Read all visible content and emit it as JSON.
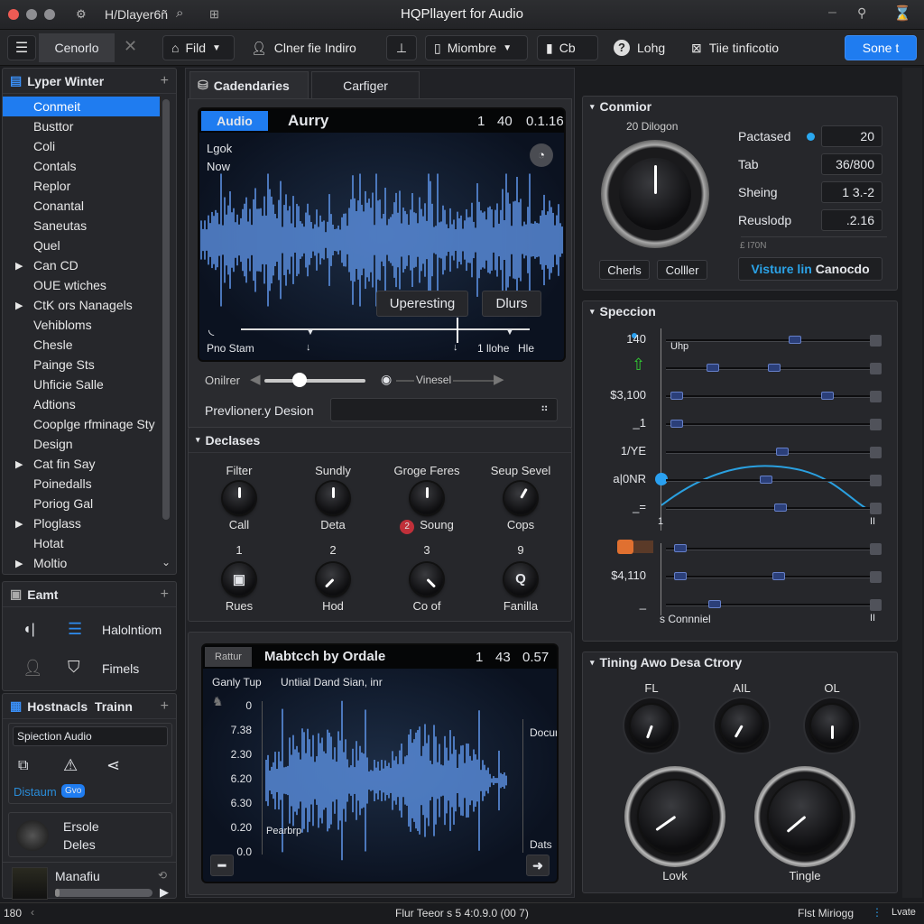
{
  "window": {
    "title": "HQPllayert for Audio",
    "left_label": "H/Dlayer6ñ",
    "controls": [
      "minimize",
      "pin",
      "close"
    ]
  },
  "toolbar": {
    "tab_label": "Cenorlo",
    "fild_label": "Fild",
    "user_label": "Clner fie Indiro",
    "monitor_label": "Miombre",
    "cam_label": "Cb",
    "help_label": "Lohg",
    "tie_label": "Tiie tinficotio",
    "primary_label": "Sone t"
  },
  "sidebar": {
    "title": "Lyper Winter",
    "items": [
      {
        "label": "Conmeit",
        "selected": true,
        "expandable": false
      },
      {
        "label": "Busttor",
        "expandable": false
      },
      {
        "label": "Coli",
        "expandable": false
      },
      {
        "label": "Contals",
        "expandable": false
      },
      {
        "label": "Replor",
        "expandable": false
      },
      {
        "label": "Conantal",
        "expandable": false
      },
      {
        "label": "Saneutas",
        "expandable": false
      },
      {
        "label": "Quel",
        "expandable": false
      },
      {
        "label": "Can CD",
        "expandable": true
      },
      {
        "label": "OUE wtiches",
        "expandable": false
      },
      {
        "label": "CtK ors Nanagels",
        "expandable": true
      },
      {
        "label": "Vehibloms",
        "expandable": false
      },
      {
        "label": "Chesle",
        "expandable": false
      },
      {
        "label": "Painge Sts",
        "expandable": false
      },
      {
        "label": "Uhficie Salle",
        "expandable": false
      },
      {
        "label": "Adtions",
        "expandable": false
      },
      {
        "label": "Cooplge rfminage Sty",
        "expandable": false
      },
      {
        "label": "Design",
        "expandable": false
      },
      {
        "label": "Cat fin Say",
        "expandable": true
      },
      {
        "label": "Poinedalls",
        "expandable": false
      },
      {
        "label": "Poriog Gal",
        "expandable": false
      },
      {
        "label": "Ploglass",
        "expandable": true
      },
      {
        "label": "Hotat",
        "expandable": false
      },
      {
        "label": "Moltio",
        "expandable": true
      }
    ],
    "eamt": {
      "title": "Eamt",
      "items": [
        {
          "label": "Halolntiom"
        },
        {
          "label": "Fimels"
        }
      ]
    },
    "hostnacls": {
      "title": "Hostnacls  Trainn",
      "input_value": "Spiection Audio",
      "link_label": "Distaum",
      "badge": "Gvo"
    },
    "profile": {
      "line1": "Ersole",
      "line2": "Deles"
    },
    "player": {
      "title": "Manafiu",
      "progress": 0.05
    }
  },
  "tabs": [
    {
      "label": "Cadendaries",
      "active": true
    },
    {
      "label": "Carfiger",
      "active": false
    }
  ],
  "audio_view": {
    "tag": "Audio",
    "title": "Aurry",
    "counters": [
      "1",
      "40",
      "0.1.16"
    ],
    "overlay_lines": [
      "Lgok",
      "Now"
    ],
    "button1": "Uperesting",
    "button2": "Dlurs",
    "footer_left": "Pno Stam",
    "footer_right1": "1 llohe",
    "footer_right2": "Hle"
  },
  "slider_row": {
    "left_label": "Onilrer",
    "value": 0.35,
    "right_label": "Vinesel"
  },
  "preview": {
    "label": "Prevlioner.y Desion",
    "value": ""
  },
  "declases": {
    "title": "Declases",
    "row1": [
      {
        "top": "Filter",
        "bottom": "Call",
        "angle": 0
      },
      {
        "top": "Sundly",
        "bottom": "Deta",
        "angle": 0
      },
      {
        "top": "Groge Feres",
        "bottom": "Soung",
        "angle": 0,
        "badge": "2"
      },
      {
        "top": "Seup Sevel",
        "bottom": "Cops",
        "angle": 30
      }
    ],
    "row2": [
      {
        "top": "1",
        "bottom": "Rues",
        "glyph": "▣"
      },
      {
        "top": "2",
        "bottom": "Hod",
        "angle": 225
      },
      {
        "top": "3",
        "bottom": "Co of",
        "angle": 135
      },
      {
        "top": "9",
        "bottom": "Fanilla",
        "glyph": "Q"
      }
    ]
  },
  "second_view": {
    "tag": "Rattur",
    "title": "Mabtcch by Ordale",
    "counters": [
      "1",
      "43",
      "0.57"
    ],
    "sub1": "Ganly Tup",
    "sub2": "Untiial Dand Sian, inr",
    "y_ticks": [
      "0",
      "7.38",
      "2.30",
      "6.20",
      "6.30",
      "0.20",
      "0.0"
    ],
    "inner_label": "Pearbrp",
    "right_top": "Docur",
    "right_bottom": "Dats"
  },
  "conmior": {
    "title": "Conmior",
    "knob_label": "20 Dilogon",
    "knob_angle": 0,
    "rows": [
      {
        "label": "Pactased",
        "value": "20",
        "dot": true
      },
      {
        "label": "Tab",
        "value": "36/800"
      },
      {
        "label": "Sheing",
        "value": "1 3.-2"
      },
      {
        "label": "Reuslodp",
        "value": ".2.16"
      }
    ],
    "small_caption": "£ I70N",
    "btn1": "Cherls",
    "btn2": "Colller",
    "wide_btn_accent": "Visture lin",
    "wide_btn_rest": "Canocdo"
  },
  "speccion": {
    "title": "Speccion",
    "row_labels": [
      "140",
      "",
      "$3,100",
      "_1",
      "1/YE",
      "a|0NR",
      "_="
    ],
    "row_handles": [
      [
        0.6
      ],
      [
        0.2,
        0.5
      ],
      [
        0.02,
        0.76
      ],
      [
        0.02
      ],
      [
        0.54
      ],
      [
        0.46
      ],
      [
        0.53
      ]
    ],
    "axis_start": "1",
    "axis_end": "II",
    "uhp_label": "Uhp",
    "rows2_labels": [
      "",
      "$4,110",
      "_"
    ],
    "rows2_handles": [
      [
        0.04
      ],
      [
        0.04,
        0.52
      ],
      [
        0.21
      ]
    ],
    "footer": "s Connniel",
    "footer_end": "II"
  },
  "timing": {
    "title": "Tining Awo Desa Ctrory",
    "small_knobs": [
      {
        "label": "FL",
        "angle": 200
      },
      {
        "label": "AIL",
        "angle": 210
      },
      {
        "label": "OL",
        "angle": 180
      }
    ],
    "big_knobs": [
      {
        "label": "Lovk",
        "angle": 235
      },
      {
        "label": "Tingle",
        "angle": 230
      }
    ]
  },
  "statusbar": {
    "left": "180",
    "center": "Flur Teeor s 5 4:0.9.0 (00 7)",
    "right": "Flst Miriogg",
    "far_right": "Lvate"
  }
}
